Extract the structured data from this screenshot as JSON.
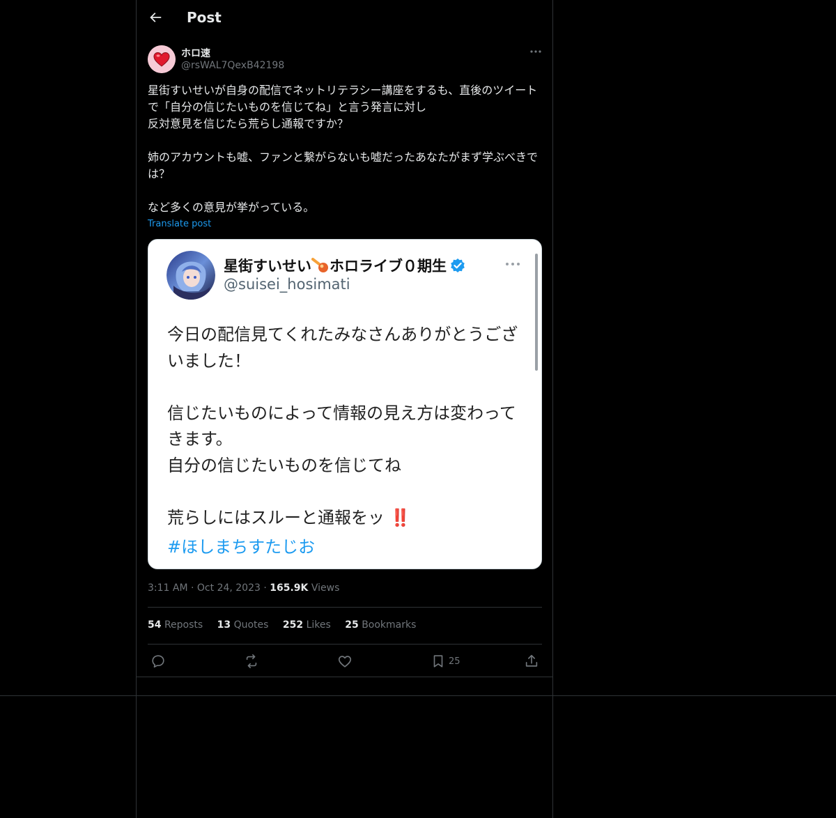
{
  "header": {
    "title": "Post"
  },
  "post": {
    "author_name": "ホロ速",
    "author_handle": "@rsWAL7QexB42198",
    "text": "星街すいせいが自身の配信でネットリテラシー講座をするも、直後のツイートで「自分の信じたいものを信じてね」と言う発言に対し\n反対意見を信じたら荒らし通報ですか？\n\n姉のアカウントも嘘、ファンと繋がらないも嘘だったあなたがまず学ぶべきでは？\n\nなど多くの意見が挙がっている。",
    "translate_label": "Translate post"
  },
  "embedded": {
    "name": "星街すいせい",
    "name_suffix": "ホロライブ０期生",
    "handle": "@suisei_hosimati",
    "text": "今日の配信見てくれたみなさんありがとうございました！\n\n信じたいものによって情報の見え方は変わってきます。\n自分の信じたいものを信じてね\n\n荒らしにはスルーと通報をッ ‼️",
    "hashtag": "#ほしまちすたじお"
  },
  "meta": {
    "time": "3:11 AM",
    "sep1": "·",
    "date": "Oct 24, 2023",
    "sep2": "·",
    "views_count": "165.9K",
    "views_label": "Views"
  },
  "stats": {
    "reposts_count": "54",
    "reposts_label": "Reposts",
    "quotes_count": "13",
    "quotes_label": "Quotes",
    "likes_count": "252",
    "likes_label": "Likes",
    "bookmarks_count": "25",
    "bookmarks_label": "Bookmarks"
  },
  "actions": {
    "bookmark_count": "25"
  },
  "icons": [
    "back-arrow-icon",
    "more-icon",
    "reply-icon",
    "repost-icon",
    "like-icon",
    "bookmark-icon",
    "share-icon",
    "verified-icon",
    "comet-icon"
  ],
  "colors": {
    "background": "#000000",
    "border": "#2f3336",
    "muted": "#71767b",
    "link": "#1d9bf0",
    "text": "#e7e9ea"
  }
}
